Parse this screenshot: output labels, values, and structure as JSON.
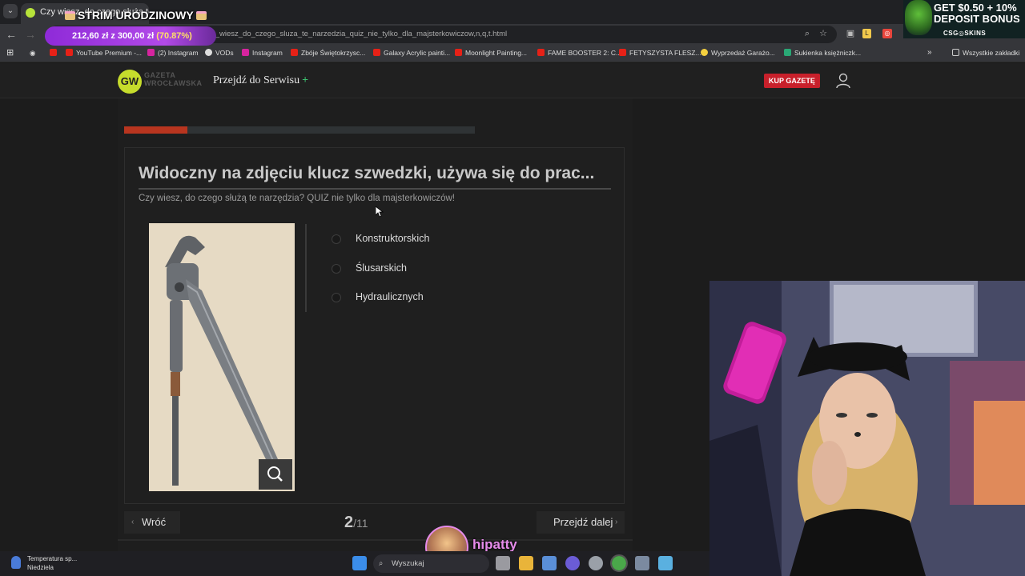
{
  "browser": {
    "tab_title": "Czy wiesz, do czego służą te…",
    "url": "…2.10413,czy_wiesz_do_czego_sluza_te_narzedzia_quiz_nie_tylko_dla_majsterkowiczow,n,q,t.html",
    "bookmarks": [
      {
        "label": "YouTube Premium -...",
        "color": "#e62117"
      },
      {
        "label": "(2) Instagram",
        "color": "#d6249f"
      },
      {
        "label": "VODs",
        "color": "#dddddd"
      },
      {
        "label": "Instagram",
        "color": "#d6249f"
      },
      {
        "label": "Zbóje Świętokrzysc...",
        "color": "#e62117"
      },
      {
        "label": "Galaxy Acrylic painti...",
        "color": "#e62117"
      },
      {
        "label": "Moonlight Painting...",
        "color": "#e62117"
      },
      {
        "label": "FAME BOOSTER 2: C...",
        "color": "#e62117"
      },
      {
        "label": "FETYSZYSTA FLESZ...",
        "color": "#e62117"
      },
      {
        "label": "Wyprzedaż Garażo...",
        "color": "#f4d03f"
      },
      {
        "label": "Sukienka księżniczk...",
        "color": "#2aa876"
      }
    ],
    "all_bookmarks": "Wszystkie zakładki"
  },
  "overlay": {
    "strim_title": "STRIM URODZINOWY",
    "goal_amount": "212,60 zł z 300,00 zł",
    "goal_percent": "(70.87%)",
    "promo_line1": "GET $0.50 + 10%",
    "promo_line2": "DEPOSIT BONUS",
    "promo_brand": "CSG◎SKINS",
    "streamer_name": "hipatty"
  },
  "site": {
    "logo_initials": "GW",
    "logo_line1": "GAZETA",
    "logo_line2": "WROCŁAWSKA",
    "serwis_link": "Przejdź do Serwisu",
    "buy_button": "KUP GAZETĘ"
  },
  "quiz": {
    "progress": 0.18,
    "question": "Widoczny na zdjęciu klucz szwedzki, używa się do prac...",
    "subtitle": "Czy wiesz, do czego służą te narzędzia? QUIZ nie tylko dla majsterkowiczów!",
    "options": [
      "Konstruktorskich",
      "Ślusarskich",
      "Hydraulicznych"
    ],
    "back_label": "Wróć",
    "next_label": "Przejdź dalej",
    "current": "2",
    "total": "/11"
  },
  "taskbar": {
    "weather_line1": "Temperatura sp...",
    "weather_line2": "Niedziela",
    "search_placeholder": "Wyszukaj"
  }
}
